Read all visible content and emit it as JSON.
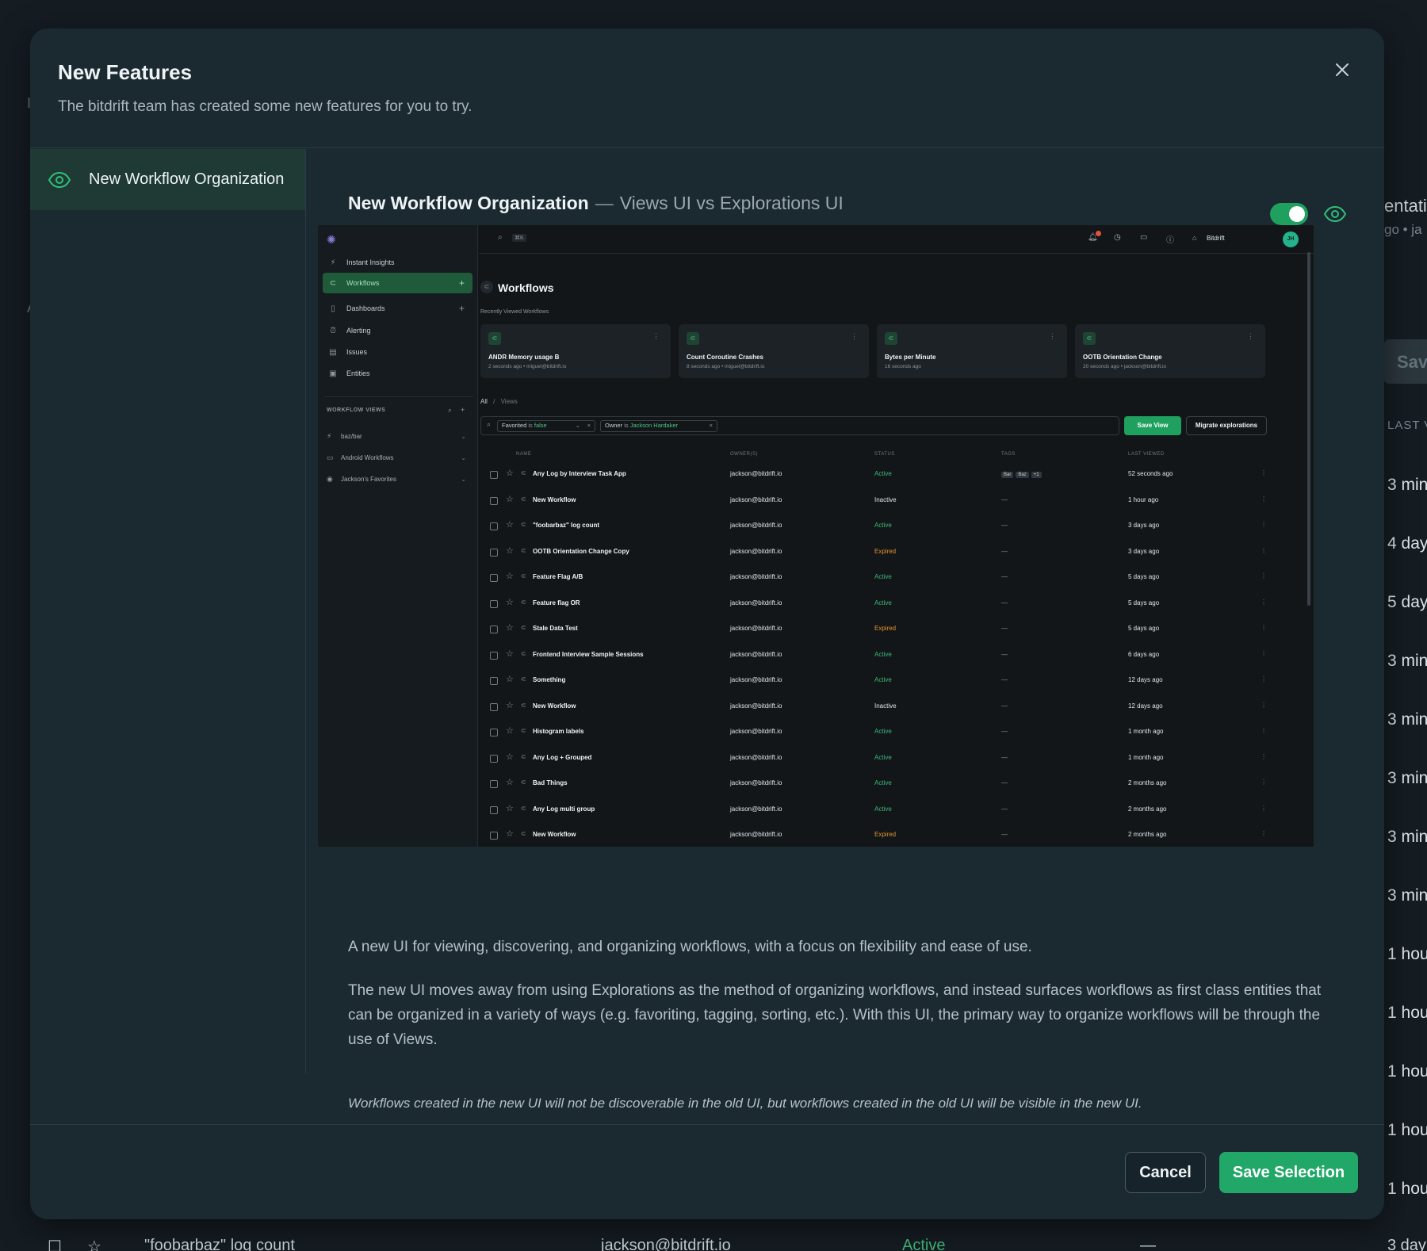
{
  "background": {
    "right_title": "entatio",
    "right_sub": "go • ja",
    "right_save": "Save",
    "right_col_header": "LAST V",
    "right_times": [
      "3 min",
      "4 day",
      "5 day",
      "3 min",
      "3 min",
      "3 min",
      "3 min",
      "3 min",
      "1 hour",
      "1 hour",
      "1 hour",
      "1 hour",
      "1 hour"
    ],
    "bottom_row": {
      "name": "\"foobarbaz\" log count",
      "owner": "jackson@bitdrift.io",
      "status": "Active",
      "tags": "—",
      "last": "3 day"
    }
  },
  "modal": {
    "title": "New Features",
    "subtitle": "The bitdrift team has created some new features for you to try.",
    "features": [
      {
        "label": "New Workflow Organization"
      }
    ],
    "detail": {
      "title": "New Workflow Organization",
      "dash": "—",
      "subtitle": "Views UI vs Explorations UI",
      "enabled": true,
      "description": "A new UI for viewing, discovering, and organizing workflows, with a focus on flexibility and ease of use.",
      "description2": "The new UI moves away from using Explorations as the method of organizing workflows, and instead surfaces workflows as first class entities that can be organized in a variety of ways (e.g. favoriting, tagging, sorting, etc.). With this UI, the primary way to organize workflows will be through the use of Views.",
      "note": "Workflows created in the new UI will not be discoverable in the old UI, but workflows created in the old UI will be visible in the new UI."
    },
    "buttons": {
      "cancel": "Cancel",
      "save": "Save Selection"
    }
  },
  "preview": {
    "nav": [
      {
        "label": "Instant Insights",
        "icon": "bolt-icon"
      },
      {
        "label": "Workflows",
        "icon": "workflow-icon",
        "active": true
      },
      {
        "label": "Dashboards",
        "icon": "document-icon"
      },
      {
        "label": "Alerting",
        "icon": "alarm-icon"
      },
      {
        "label": "Issues",
        "icon": "issues-icon"
      },
      {
        "label": "Entities",
        "icon": "entities-icon"
      }
    ],
    "section_label": "WORKFLOW VIEWS",
    "views": [
      "baz/bar",
      "Android Workflows",
      "Jackson's Favorites"
    ],
    "search_kbd": "⌘K",
    "org": "Bitdrift",
    "notification_count": "3",
    "avatar": "JH",
    "page_title": "Workflows",
    "recent_label": "Recently Viewed Workflows",
    "cards": [
      {
        "title": "ANDR Memory usage B",
        "sub": "2 seconds ago • miguel@bitdrift.io"
      },
      {
        "title": "Count Coroutine Crashes",
        "sub": "8 seconds ago • miguel@bitdrift.io"
      },
      {
        "title": "Bytes per Minute",
        "sub": "16 seconds ago"
      },
      {
        "title": "OOTB Orientation Change",
        "sub": "20 seconds ago • jackson@bitdrift.io"
      }
    ],
    "crumb": {
      "all": "All",
      "sep": "/",
      "views": "Views"
    },
    "filters": [
      {
        "key": "Favorited",
        "op": "is",
        "value": "false"
      },
      {
        "key": "Owner",
        "op": "is",
        "value": "Jackson Hardaker"
      }
    ],
    "save_view": "Save View",
    "migrate": "Migrate explorations",
    "columns": [
      "NAME",
      "OWNER(S)",
      "STATUS",
      "TAGS",
      "LAST VIEWED"
    ],
    "rows": [
      {
        "name": "Any Log by Interview Task App",
        "owner": "jackson@bitdrift.io",
        "status": "Active",
        "tags": [
          "Bar",
          "Baz",
          "+1"
        ],
        "last": "52 seconds ago"
      },
      {
        "name": "New Workflow",
        "owner": "jackson@bitdrift.io",
        "status": "Inactive",
        "tags": [],
        "last": "1 hour ago"
      },
      {
        "name": "\"foobarbaz\" log count",
        "owner": "jackson@bitdrift.io",
        "status": "Active",
        "tags": [],
        "last": "3 days ago"
      },
      {
        "name": "OOTB Orientation Change Copy",
        "owner": "jackson@bitdrift.io",
        "status": "Expired",
        "tags": [],
        "last": "3 days ago"
      },
      {
        "name": "Feature Flag A/B",
        "owner": "jackson@bitdrift.io",
        "status": "Active",
        "tags": [],
        "last": "5 days ago"
      },
      {
        "name": "Feature flag OR",
        "owner": "jackson@bitdrift.io",
        "status": "Active",
        "tags": [],
        "last": "5 days ago"
      },
      {
        "name": "Stale Data Test",
        "owner": "jackson@bitdrift.io",
        "status": "Expired",
        "tags": [],
        "last": "5 days ago"
      },
      {
        "name": "Frontend Interview Sample Sessions",
        "owner": "jackson@bitdrift.io",
        "status": "Active",
        "tags": [],
        "last": "6 days ago"
      },
      {
        "name": "Something",
        "owner": "jackson@bitdrift.io",
        "status": "Active",
        "tags": [],
        "last": "12 days ago"
      },
      {
        "name": "New Workflow",
        "owner": "jackson@bitdrift.io",
        "status": "Inactive",
        "tags": [],
        "last": "12 days ago"
      },
      {
        "name": "Histogram labels",
        "owner": "jackson@bitdrift.io",
        "status": "Active",
        "tags": [],
        "last": "1 month ago"
      },
      {
        "name": "Any Log + Grouped",
        "owner": "jackson@bitdrift.io",
        "status": "Active",
        "tags": [],
        "last": "1 month ago"
      },
      {
        "name": "Bad Things",
        "owner": "jackson@bitdrift.io",
        "status": "Active",
        "tags": [],
        "last": "2 months ago"
      },
      {
        "name": "Any Log multi group",
        "owner": "jackson@bitdrift.io",
        "status": "Active",
        "tags": [],
        "last": "2 months ago"
      },
      {
        "name": "New Workflow",
        "owner": "jackson@bitdrift.io",
        "status": "Expired",
        "tags": [],
        "last": "2 months ago"
      }
    ],
    "empty_tag": "—"
  }
}
